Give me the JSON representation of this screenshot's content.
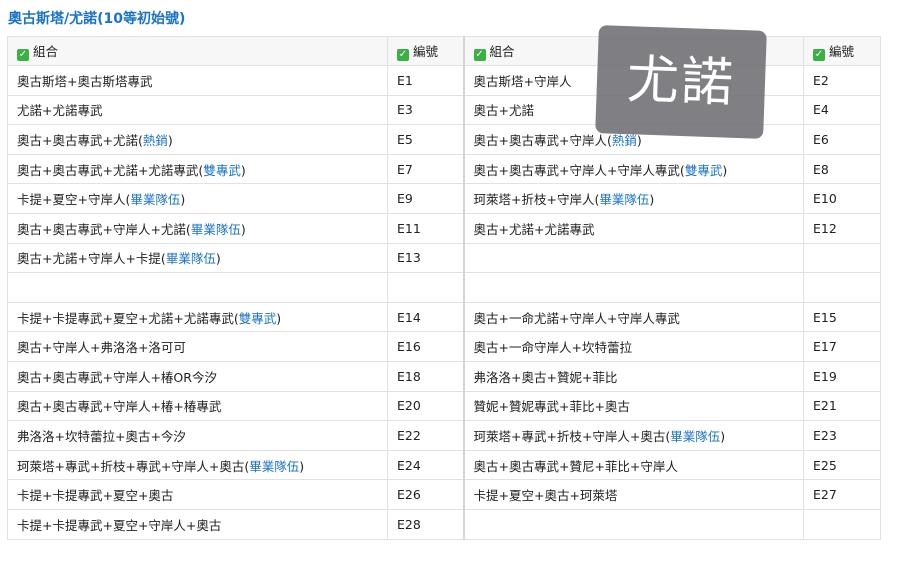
{
  "title": "奧古斯塔/尤諾(10等初始號)",
  "watermark": "尤諾",
  "headers": {
    "combo": "組合",
    "code": "編號",
    "combo2": "組合",
    "code2": "編號",
    "check_icon": "check-square-icon",
    "check_color": "#3cb043"
  },
  "colors": {
    "title": "#1a73c9",
    "tag": "#1a73c9"
  },
  "rows": [
    {
      "l": {
        "text": "奧古斯塔+奧古斯塔專武",
        "tag": ""
      },
      "lc": "E1",
      "r": {
        "text": "奧古斯塔+守岸人",
        "tag": ""
      },
      "rc": "E2"
    },
    {
      "l": {
        "text": "尤諾+尤諾專武",
        "tag": ""
      },
      "lc": "E3",
      "r": {
        "text": "奧古+尤諾",
        "tag": ""
      },
      "rc": "E4"
    },
    {
      "l": {
        "text": "奧古+奧古專武+尤諾(",
        "tag": "熱銷"
      },
      "lc": "E5",
      "r": {
        "text": "奧古+奧古專武+守岸人(",
        "tag": "熱銷"
      },
      "rc": "E6"
    },
    {
      "l": {
        "text": "奧古+奧古專武+尤諾+尤諾專武(",
        "tag": "雙專武"
      },
      "lc": "E7",
      "r": {
        "text": "奧古+奧古專武+守岸人+守岸人專武(",
        "tag": "雙專武"
      },
      "rc": "E8"
    },
    {
      "l": {
        "text": "卡提+夏空+守岸人(",
        "tag": "畢業隊伍"
      },
      "lc": "E9",
      "r": {
        "text": "珂萊塔+折枝+守岸人(",
        "tag": "畢業隊伍"
      },
      "rc": "E10"
    },
    {
      "l": {
        "text": "奧古+奧古專武+守岸人+尤諾(",
        "tag": "畢業隊伍"
      },
      "lc": "E11",
      "r": {
        "text": "奧古+尤諾+尤諾專武",
        "tag": ""
      },
      "rc": "E12"
    },
    {
      "l": {
        "text": "奧古+尤諾+守岸人+卡提(",
        "tag": "畢業隊伍"
      },
      "lc": "E13",
      "r": {
        "text": "",
        "tag": ""
      },
      "rc": ""
    },
    {
      "l": {
        "text": "",
        "tag": ""
      },
      "lc": "",
      "r": {
        "text": "",
        "tag": ""
      },
      "rc": ""
    },
    {
      "l": {
        "text": "卡提+卡提專武+夏空+尤諾+尤諾專武(",
        "tag": "雙專武"
      },
      "lc": "E14",
      "r": {
        "text": "奧古+一命尤諾+守岸人+守岸人專武",
        "tag": ""
      },
      "rc": "E15"
    },
    {
      "l": {
        "text": "奧古+守岸人+弗洛洛+洛可可",
        "tag": ""
      },
      "lc": "E16",
      "r": {
        "text": "奧古+一命守岸人+坎特蕾拉",
        "tag": ""
      },
      "rc": "E17"
    },
    {
      "l": {
        "text": "奧古+奧古專武+守岸人+椿OR今汐",
        "tag": ""
      },
      "lc": "E18",
      "r": {
        "text": "弗洛洛+奧古+贊妮+菲比",
        "tag": ""
      },
      "rc": "E19"
    },
    {
      "l": {
        "text": "奧古+奧古專武+守岸人+椿+椿專武",
        "tag": ""
      },
      "lc": "E20",
      "r": {
        "text": "贊妮+贊妮專武+菲比+奧古",
        "tag": ""
      },
      "rc": "E21"
    },
    {
      "l": {
        "text": "弗洛洛+坎特蕾拉+奧古+今汐",
        "tag": ""
      },
      "lc": "E22",
      "r": {
        "text": "珂萊塔+專武+折枝+守岸人+奧古(",
        "tag": "畢業隊伍"
      },
      "rc": "E23"
    },
    {
      "l": {
        "text": "珂萊塔+專武+折枝+專武+守岸人+奧古(",
        "tag": "畢業隊伍"
      },
      "lc": "E24",
      "r": {
        "text": "奧古+奧古專武+贊尼+菲比+守岸人",
        "tag": ""
      },
      "rc": "E25"
    },
    {
      "l": {
        "text": "卡提+卡提專武+夏空+奧古",
        "tag": ""
      },
      "lc": "E26",
      "r": {
        "text": "卡提+夏空+奧古+珂萊塔",
        "tag": ""
      },
      "rc": "E27"
    },
    {
      "l": {
        "text": "卡提+卡提專武+夏空+守岸人+奧古",
        "tag": ""
      },
      "lc": "E28",
      "r": {
        "text": "",
        "tag": ""
      },
      "rc": ""
    }
  ]
}
